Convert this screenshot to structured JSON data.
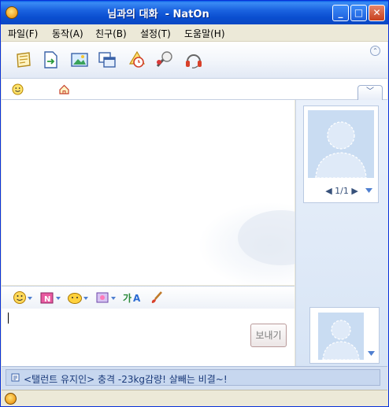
{
  "window": {
    "title": "님과의 대화  - NatOn",
    "minimize_label": "_",
    "maximize_label": "□",
    "close_label": "✕"
  },
  "menu": {
    "items": [
      {
        "label": "파일(F)"
      },
      {
        "label": "동작(A)"
      },
      {
        "label": "친구(B)"
      },
      {
        "label": "설정(T)"
      },
      {
        "label": "도움말(H)"
      }
    ]
  },
  "toolbar": {
    "buttons": [
      "memo-icon",
      "file-send-icon",
      "photo-icon",
      "window-icon",
      "alarm-icon",
      "voice-icon",
      "headset-icon"
    ],
    "collapse_label": "⌃"
  },
  "strip": {
    "tab_label": "﹀"
  },
  "profile": {
    "pager_text": "◀ 1/1 ▶"
  },
  "composer": {
    "send_label": "보내기"
  },
  "ad": {
    "text": "<탤런트 유지인> 충격 -23kg감량! 살빼는 비결~!"
  },
  "colors": {
    "titlebar": "#0a4ed0",
    "panel": "#d7e4f5",
    "ad_text": "#1a3a7a"
  }
}
